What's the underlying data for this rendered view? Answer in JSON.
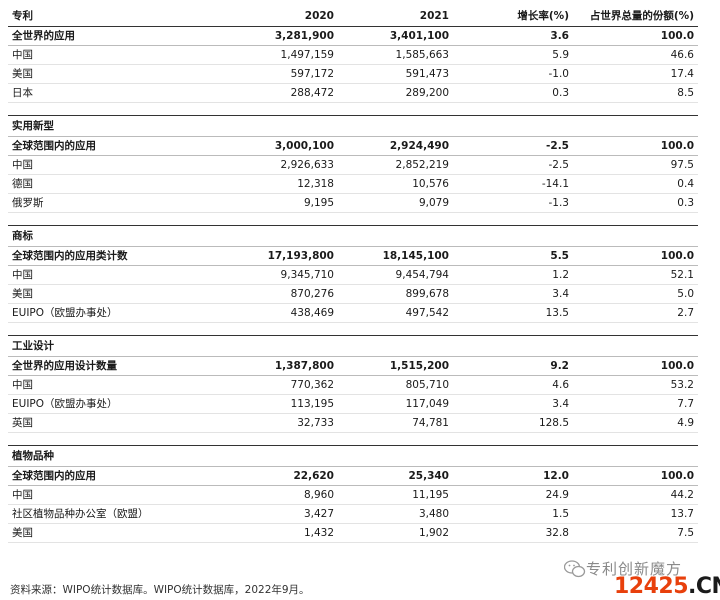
{
  "header": {
    "label": "专利",
    "y2020": "2020",
    "y2021": "2021",
    "growth": "增长率(%)",
    "share": "占世界总量的份额(%)"
  },
  "sections": [
    {
      "title": "专利",
      "rows": [
        {
          "name": "全世界的应用",
          "y2020": "3,281,900",
          "y2021": "3,401,100",
          "growth": "3.6",
          "share": "100.0",
          "total": true
        },
        {
          "name": "中国",
          "y2020": "1,497,159",
          "y2021": "1,585,663",
          "growth": "5.9",
          "share": "46.6"
        },
        {
          "name": "美国",
          "y2020": "597,172",
          "y2021": "591,473",
          "growth": "-1.0",
          "share": "17.4"
        },
        {
          "name": "日本",
          "y2020": "288,472",
          "y2021": "289,200",
          "growth": "0.3",
          "share": "8.5"
        }
      ]
    },
    {
      "title": "实用新型",
      "rows": [
        {
          "name": "全球范围内的应用",
          "y2020": "3,000,100",
          "y2021": "2,924,490",
          "growth": "-2.5",
          "share": "100.0",
          "total": true
        },
        {
          "name": "中国",
          "y2020": "2,926,633",
          "y2021": "2,852,219",
          "growth": "-2.5",
          "share": "97.5"
        },
        {
          "name": "德国",
          "y2020": "12,318",
          "y2021": "10,576",
          "growth": "-14.1",
          "share": "0.4"
        },
        {
          "name": "俄罗斯",
          "y2020": "9,195",
          "y2021": "9,079",
          "growth": "-1.3",
          "share": "0.3"
        }
      ]
    },
    {
      "title": "商标",
      "rows": [
        {
          "name": "全球范围内的应用类计数",
          "y2020": "17,193,800",
          "y2021": "18,145,100",
          "growth": "5.5",
          "share": "100.0",
          "total": true
        },
        {
          "name": "中国",
          "y2020": "9,345,710",
          "y2021": "9,454,794",
          "growth": "1.2",
          "share": "52.1"
        },
        {
          "name": "美国",
          "y2020": "870,276",
          "y2021": "899,678",
          "growth": "3.4",
          "share": "5.0"
        },
        {
          "name": "EUIPO（欧盟办事处）",
          "y2020": "438,469",
          "y2021": "497,542",
          "growth": "13.5",
          "share": "2.7"
        }
      ]
    },
    {
      "title": "工业设计",
      "rows": [
        {
          "name": "全世界的应用设计数量",
          "y2020": "1,387,800",
          "y2021": "1,515,200",
          "growth": "9.2",
          "share": "100.0",
          "total": true
        },
        {
          "name": "中国",
          "y2020": "770,362",
          "y2021": "805,710",
          "growth": "4.6",
          "share": "53.2"
        },
        {
          "name": "EUIPO（欧盟办事处）",
          "y2020": "113,195",
          "y2021": "117,049",
          "growth": "3.4",
          "share": "7.7"
        },
        {
          "name": "英国",
          "y2020": "32,733",
          "y2021": "74,781",
          "growth": "128.5",
          "share": "4.9"
        }
      ]
    },
    {
      "title": "植物品种",
      "rows": [
        {
          "name": "全球范围内的应用",
          "y2020": "22,620",
          "y2021": "25,340",
          "growth": "12.0",
          "share": "100.0",
          "total": true
        },
        {
          "name": "中国",
          "y2020": "8,960",
          "y2021": "11,195",
          "growth": "24.9",
          "share": "44.2"
        },
        {
          "name": "社区植物品种办公室（欧盟）",
          "y2020": "3,427",
          "y2021": "3,480",
          "growth": "1.5",
          "share": "13.7"
        },
        {
          "name": "美国",
          "y2020": "1,432",
          "y2021": "1,902",
          "growth": "32.8",
          "share": "7.5"
        }
      ]
    }
  ],
  "source": "资料来源：WIPO统计数据库。WIPO统计数据库，2022年9月。",
  "watermark": {
    "text": "专利创新魔方",
    "site_num": "12425",
    "site_dom": ".CN",
    "num_color": "#e8400c"
  }
}
